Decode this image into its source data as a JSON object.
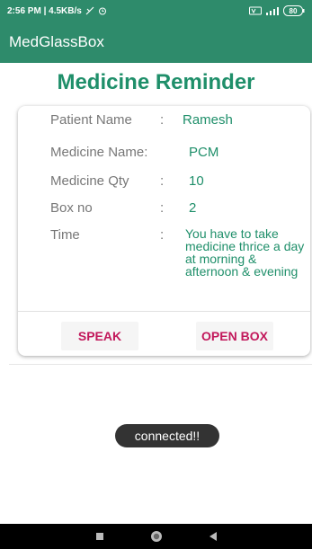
{
  "status_bar": {
    "time_speed": "2:56 PM | 4.5KB/s",
    "left_icons": [
      "signal-off-icon",
      "alarm-icon"
    ],
    "right_icons": [
      "volte-icon",
      "cellular-signal-icon",
      "battery-icon"
    ],
    "battery": "80"
  },
  "toolbar": {
    "title": "MedGlassBox"
  },
  "page": {
    "title": "Medicine Reminder"
  },
  "details": {
    "patient_name": {
      "label": "Patient Name",
      "colon": ":",
      "value": "Ramesh"
    },
    "medicine_name": {
      "label": "Medicine Name:",
      "colon": "",
      "value": "PCM"
    },
    "medicine_qty": {
      "label": "Medicine Qty",
      "colon": ":",
      "value": "10"
    },
    "box_no": {
      "label": "Box no",
      "colon": ":",
      "value": "2"
    },
    "time": {
      "label": "Time",
      "colon": ":",
      "value": "You have to take medicine thrice a day at morning & afternoon & evening"
    }
  },
  "buttons": {
    "speak": "SPEAK",
    "open_box": "OPEN BOX"
  },
  "toast": {
    "message": "connected!!"
  },
  "nav_bar": {
    "icons": [
      "recents-icon",
      "home-icon",
      "back-icon"
    ]
  },
  "colors": {
    "primary": "#2e8b6b",
    "title_accent": "#1f8f6a",
    "button_text": "#c2185b",
    "toast_bg": "#333333"
  }
}
